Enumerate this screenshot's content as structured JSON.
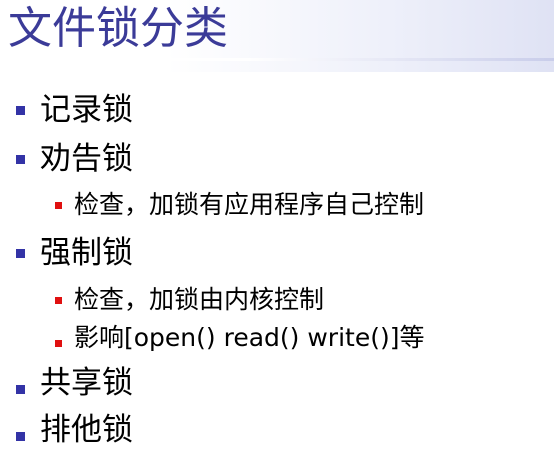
{
  "slide": {
    "title": "文件锁分类",
    "items": [
      {
        "level": 1,
        "text": "记录锁"
      },
      {
        "level": 1,
        "text": "劝告锁"
      },
      {
        "level": 2,
        "text": "检查，加锁有应用程序自己控制"
      },
      {
        "level": 1,
        "text": "强制锁"
      },
      {
        "level": 2,
        "text": "检查，加锁由内核控制"
      },
      {
        "level": 2,
        "text": "影响[open() read()  write()]等"
      },
      {
        "level": 1,
        "text": "共享锁"
      },
      {
        "level": 1,
        "text": "排他锁"
      }
    ]
  },
  "colors": {
    "title": "#3b3b98",
    "bullet_level1": "#3333a6",
    "bullet_level2": "#e01010",
    "text": "#000000",
    "background": "#ffffff"
  },
  "icons": {
    "bullet_level1": "square-bullet-icon",
    "bullet_level2": "small-square-bullet-icon"
  }
}
